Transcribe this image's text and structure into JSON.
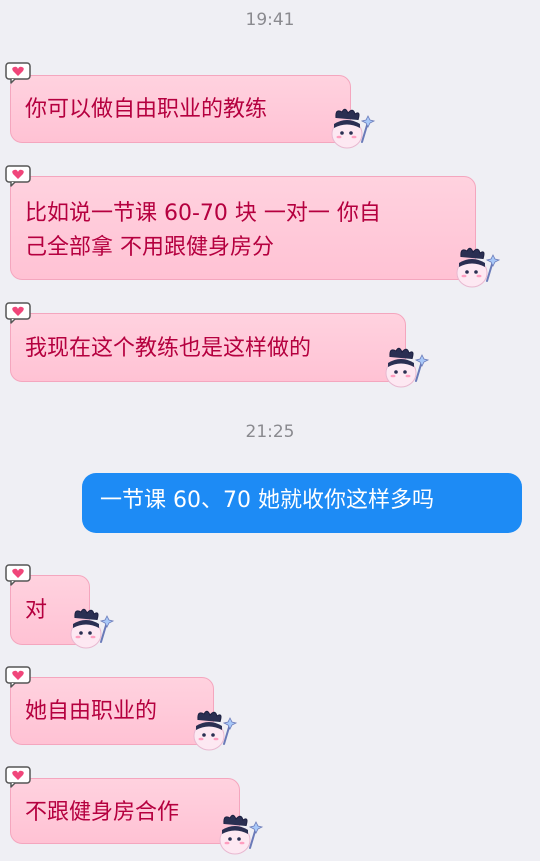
{
  "colors": {
    "incoming_bg": "#ffc8d8",
    "incoming_border": "#f4a6be",
    "incoming_text": "#b5003f",
    "outgoing_bg": "#1d8bf5",
    "outgoing_text": "#ffffff",
    "background": "#efeff4",
    "timestamp_text": "#8a8a8f"
  },
  "chat": {
    "timestamps": [
      "19:41",
      "21:25"
    ],
    "messages": [
      {
        "side": "incoming",
        "text_lines": [
          "你可以做自由职业的教练"
        ]
      },
      {
        "side": "incoming",
        "text_lines": [
          "比如说一节课 60-70 块 一对一 你自",
          "己全部拿 不用跟健身房分"
        ]
      },
      {
        "side": "incoming",
        "text_lines": [
          "我现在这个教练也是这样做的"
        ]
      },
      {
        "side": "outgoing",
        "text_lines": [
          "一节课 60、70 她就收你这样多吗"
        ]
      },
      {
        "side": "incoming",
        "text_lines": [
          "对"
        ]
      },
      {
        "side": "incoming",
        "text_lines": [
          "她自由职业的"
        ]
      },
      {
        "side": "incoming",
        "text_lines": [
          "不跟健身房合作"
        ]
      }
    ],
    "decorations": {
      "bubble_corner_icon": "pixel-heart-icon",
      "bubble_sticker_icon": "ghost-mascot-icon"
    }
  }
}
